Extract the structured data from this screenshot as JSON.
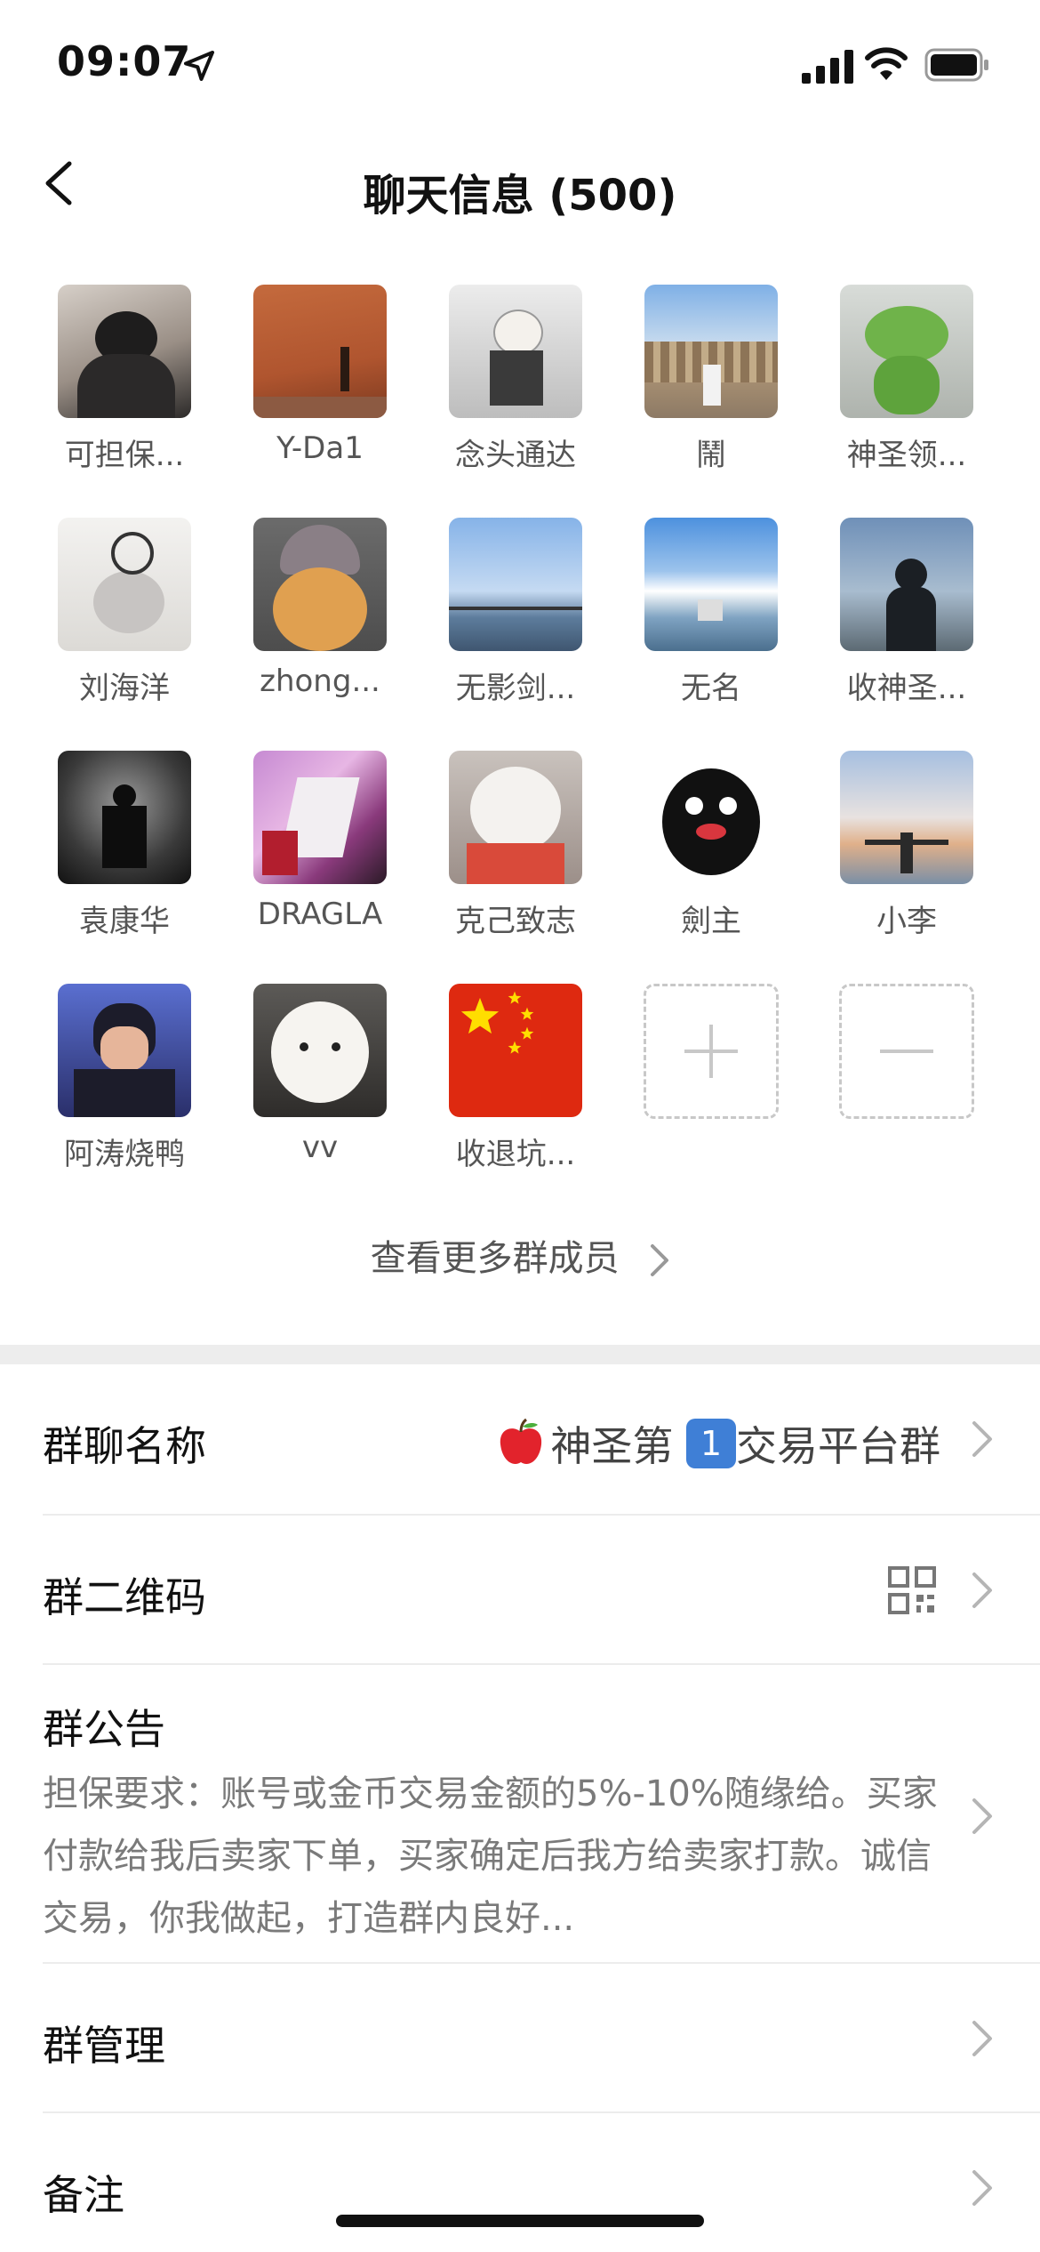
{
  "status_bar": {
    "time": "09:07"
  },
  "header": {
    "title": "聊天信息 (500)"
  },
  "members": [
    {
      "name": "可担保..."
    },
    {
      "name": "Y-Da1"
    },
    {
      "name": "念头通达"
    },
    {
      "name": "鬧"
    },
    {
      "name": "神圣领..."
    },
    {
      "name": "刘海洋"
    },
    {
      "name": "zhong..."
    },
    {
      "name": "无影剑..."
    },
    {
      "name": "无名"
    },
    {
      "name": "收神圣..."
    },
    {
      "name": "袁康华"
    },
    {
      "name": "DRAGLA"
    },
    {
      "name": "克己致志"
    },
    {
      "name": "劍主"
    },
    {
      "name": "小李"
    },
    {
      "name": "阿涛烧鸭"
    },
    {
      "name": "vv"
    },
    {
      "name": "收退坑..."
    }
  ],
  "view_more": "查看更多群成员",
  "settings": {
    "group_name_label": "群聊名称",
    "group_name_prefix": "神圣第",
    "group_name_badge": "1",
    "group_name_suffix": "交易平台群",
    "qr_label": "群二维码",
    "notice_label": "群公告",
    "notice_text": "担保要求：账号或金币交易金额的5%-10%随缘给。买家付款给我后卖家下单，买家确定后我方给卖家打款。诚信交易，你我做起，打造群内良好...",
    "manage_label": "群管理",
    "remark_label": "备注"
  }
}
